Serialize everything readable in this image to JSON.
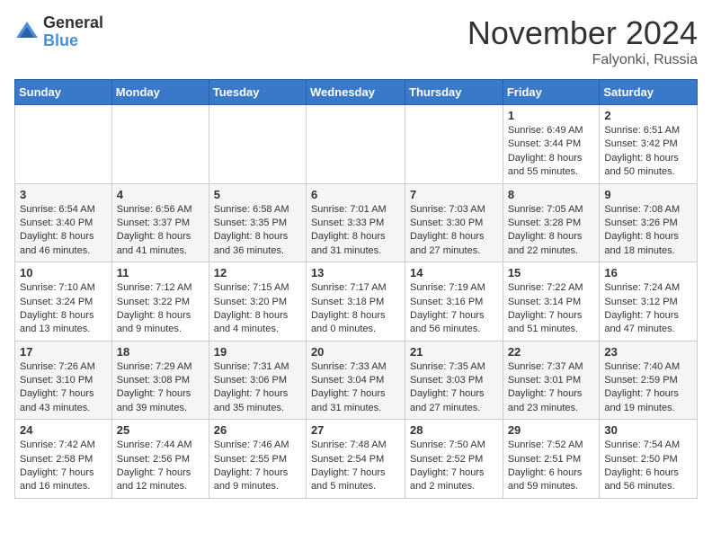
{
  "header": {
    "logo_general": "General",
    "logo_blue": "Blue",
    "month_title": "November 2024",
    "location": "Falyonki, Russia"
  },
  "days_of_week": [
    "Sunday",
    "Monday",
    "Tuesday",
    "Wednesday",
    "Thursday",
    "Friday",
    "Saturday"
  ],
  "weeks": [
    [
      {
        "day": "",
        "info": ""
      },
      {
        "day": "",
        "info": ""
      },
      {
        "day": "",
        "info": ""
      },
      {
        "day": "",
        "info": ""
      },
      {
        "day": "",
        "info": ""
      },
      {
        "day": "1",
        "info": "Sunrise: 6:49 AM\nSunset: 3:44 PM\nDaylight: 8 hours and 55 minutes."
      },
      {
        "day": "2",
        "info": "Sunrise: 6:51 AM\nSunset: 3:42 PM\nDaylight: 8 hours and 50 minutes."
      }
    ],
    [
      {
        "day": "3",
        "info": "Sunrise: 6:54 AM\nSunset: 3:40 PM\nDaylight: 8 hours and 46 minutes."
      },
      {
        "day": "4",
        "info": "Sunrise: 6:56 AM\nSunset: 3:37 PM\nDaylight: 8 hours and 41 minutes."
      },
      {
        "day": "5",
        "info": "Sunrise: 6:58 AM\nSunset: 3:35 PM\nDaylight: 8 hours and 36 minutes."
      },
      {
        "day": "6",
        "info": "Sunrise: 7:01 AM\nSunset: 3:33 PM\nDaylight: 8 hours and 31 minutes."
      },
      {
        "day": "7",
        "info": "Sunrise: 7:03 AM\nSunset: 3:30 PM\nDaylight: 8 hours and 27 minutes."
      },
      {
        "day": "8",
        "info": "Sunrise: 7:05 AM\nSunset: 3:28 PM\nDaylight: 8 hours and 22 minutes."
      },
      {
        "day": "9",
        "info": "Sunrise: 7:08 AM\nSunset: 3:26 PM\nDaylight: 8 hours and 18 minutes."
      }
    ],
    [
      {
        "day": "10",
        "info": "Sunrise: 7:10 AM\nSunset: 3:24 PM\nDaylight: 8 hours and 13 minutes."
      },
      {
        "day": "11",
        "info": "Sunrise: 7:12 AM\nSunset: 3:22 PM\nDaylight: 8 hours and 9 minutes."
      },
      {
        "day": "12",
        "info": "Sunrise: 7:15 AM\nSunset: 3:20 PM\nDaylight: 8 hours and 4 minutes."
      },
      {
        "day": "13",
        "info": "Sunrise: 7:17 AM\nSunset: 3:18 PM\nDaylight: 8 hours and 0 minutes."
      },
      {
        "day": "14",
        "info": "Sunrise: 7:19 AM\nSunset: 3:16 PM\nDaylight: 7 hours and 56 minutes."
      },
      {
        "day": "15",
        "info": "Sunrise: 7:22 AM\nSunset: 3:14 PM\nDaylight: 7 hours and 51 minutes."
      },
      {
        "day": "16",
        "info": "Sunrise: 7:24 AM\nSunset: 3:12 PM\nDaylight: 7 hours and 47 minutes."
      }
    ],
    [
      {
        "day": "17",
        "info": "Sunrise: 7:26 AM\nSunset: 3:10 PM\nDaylight: 7 hours and 43 minutes."
      },
      {
        "day": "18",
        "info": "Sunrise: 7:29 AM\nSunset: 3:08 PM\nDaylight: 7 hours and 39 minutes."
      },
      {
        "day": "19",
        "info": "Sunrise: 7:31 AM\nSunset: 3:06 PM\nDaylight: 7 hours and 35 minutes."
      },
      {
        "day": "20",
        "info": "Sunrise: 7:33 AM\nSunset: 3:04 PM\nDaylight: 7 hours and 31 minutes."
      },
      {
        "day": "21",
        "info": "Sunrise: 7:35 AM\nSunset: 3:03 PM\nDaylight: 7 hours and 27 minutes."
      },
      {
        "day": "22",
        "info": "Sunrise: 7:37 AM\nSunset: 3:01 PM\nDaylight: 7 hours and 23 minutes."
      },
      {
        "day": "23",
        "info": "Sunrise: 7:40 AM\nSunset: 2:59 PM\nDaylight: 7 hours and 19 minutes."
      }
    ],
    [
      {
        "day": "24",
        "info": "Sunrise: 7:42 AM\nSunset: 2:58 PM\nDaylight: 7 hours and 16 minutes."
      },
      {
        "day": "25",
        "info": "Sunrise: 7:44 AM\nSunset: 2:56 PM\nDaylight: 7 hours and 12 minutes."
      },
      {
        "day": "26",
        "info": "Sunrise: 7:46 AM\nSunset: 2:55 PM\nDaylight: 7 hours and 9 minutes."
      },
      {
        "day": "27",
        "info": "Sunrise: 7:48 AM\nSunset: 2:54 PM\nDaylight: 7 hours and 5 minutes."
      },
      {
        "day": "28",
        "info": "Sunrise: 7:50 AM\nSunset: 2:52 PM\nDaylight: 7 hours and 2 minutes."
      },
      {
        "day": "29",
        "info": "Sunrise: 7:52 AM\nSunset: 2:51 PM\nDaylight: 6 hours and 59 minutes."
      },
      {
        "day": "30",
        "info": "Sunrise: 7:54 AM\nSunset: 2:50 PM\nDaylight: 6 hours and 56 minutes."
      }
    ]
  ]
}
